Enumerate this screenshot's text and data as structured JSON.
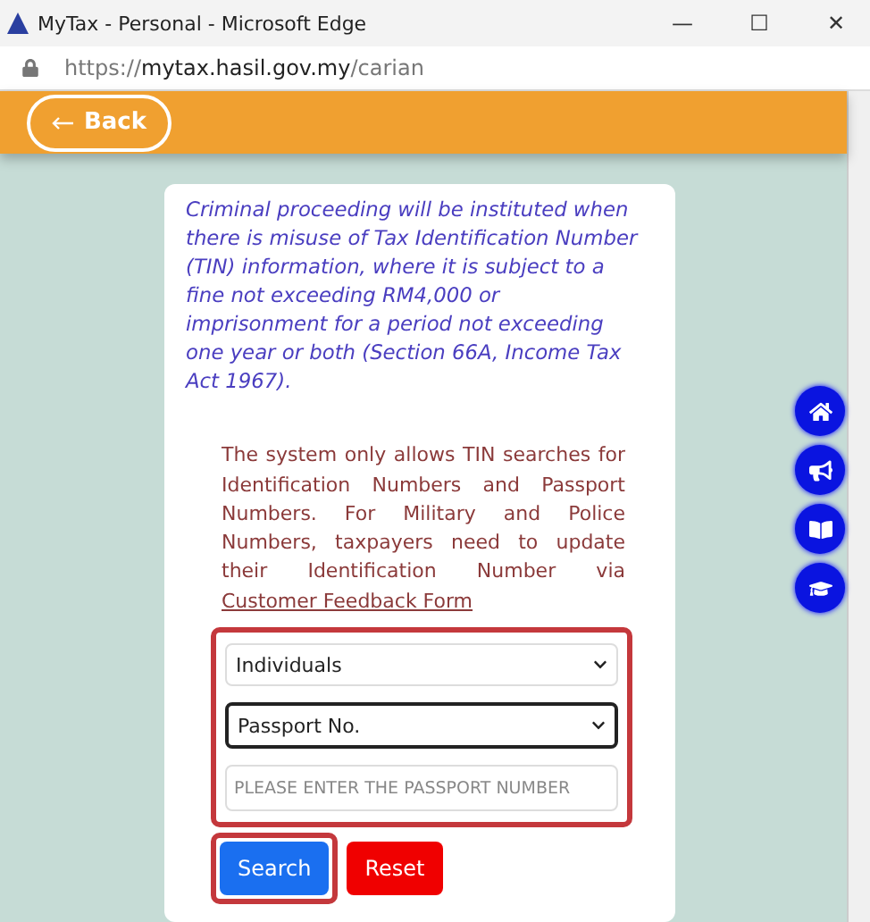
{
  "window": {
    "title": "MyTax - Personal - Microsoft Edge",
    "controls": [
      "—",
      "☐",
      "✕"
    ]
  },
  "address_bar": {
    "url": "https://**mytax.hasil.gov.my**/carian"
  },
  "header": {
    "back_button": "Back"
  },
  "notice": {
    "warning": "Criminal proceeding will be instituted when there is misuse of Tax Identification Number (TIN) information, where it is subject to a fine not exceeding RM4,000 or imprisonment for a period not exceeding one year or both (Section 66A, Income Tax Act 1967).",
    "info": "The system only allows TIN searches for Identification Numbers and Passport Numbers. For Military and Police Numbers, taxpayers need to update their Identification Number via",
    "link": "Customer Feedback Form"
  },
  "form": {
    "highlighted": true,
    "category": {
      "value": "Individuals",
      "focused": false
    },
    "id_type": {
      "value": "Passport No.",
      "focused": true
    },
    "id_number": {
      "placeholder": "PLEASE ENTER THE PASSPORT NUMBER"
    },
    "buttons": [
      {
        "label": "Search",
        "kind": "primary",
        "highlighted": true
      },
      {
        "label": "Reset",
        "kind": "danger",
        "highlighted": false
      }
    ]
  },
  "floating_menu": [
    {
      "kind": "home"
    },
    {
      "kind": "announcement"
    },
    {
      "kind": "guide"
    },
    {
      "kind": "learning"
    }
  ]
}
